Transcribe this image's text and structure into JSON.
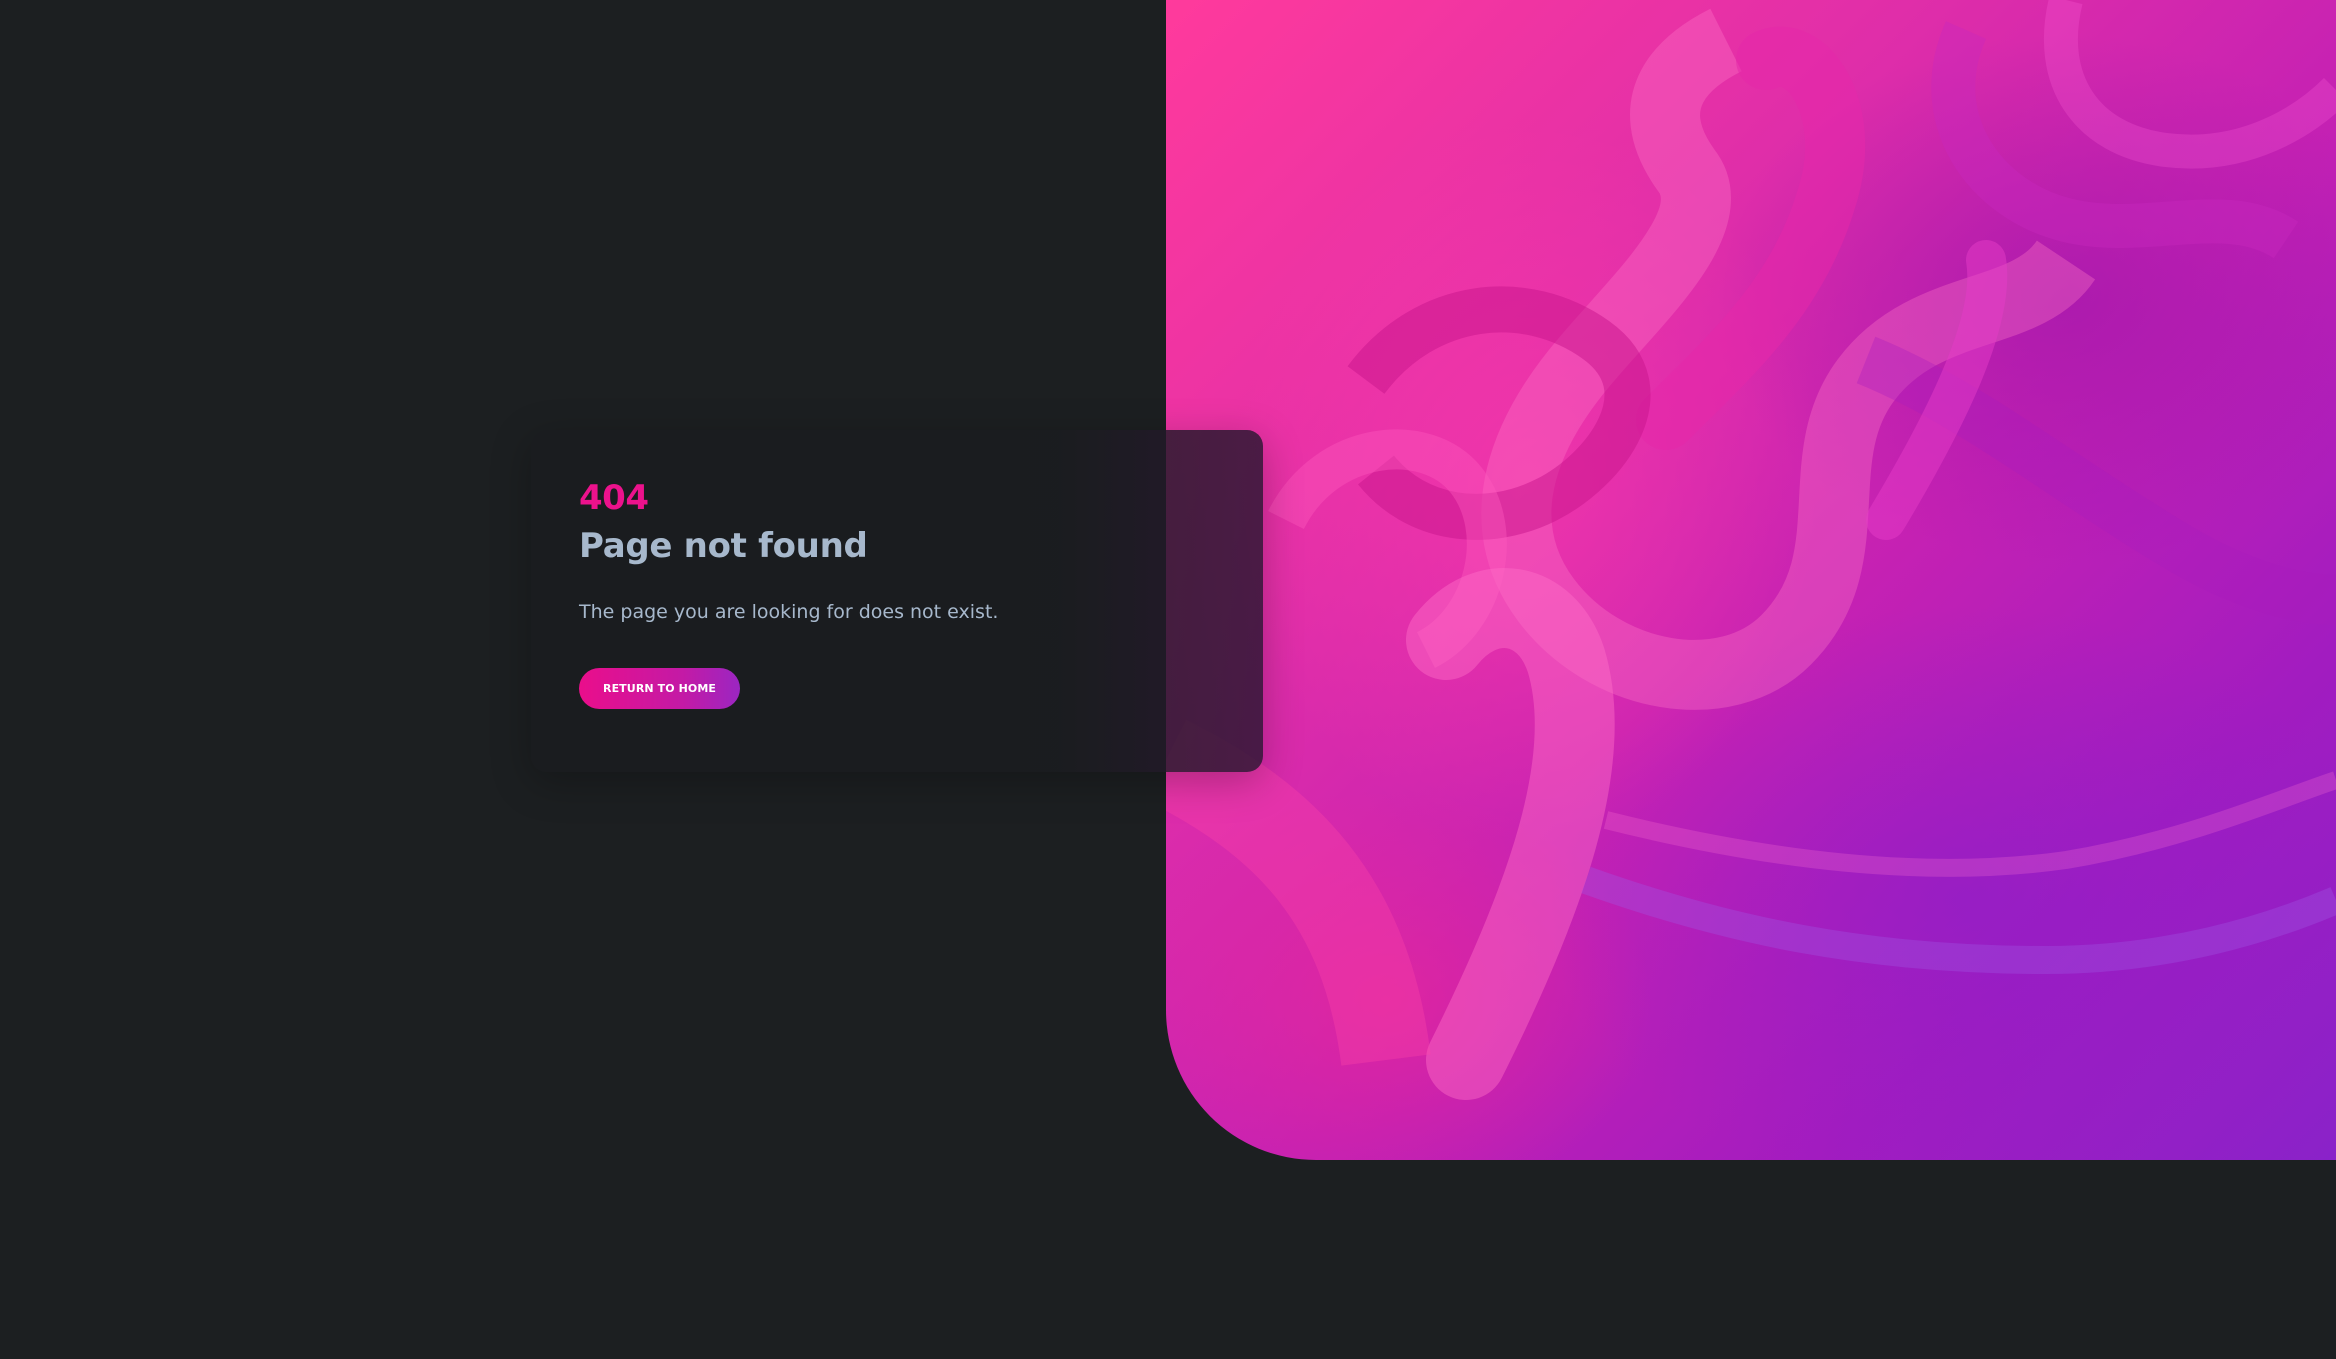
{
  "error": {
    "code": "404",
    "title": "Page not found",
    "message": "The page you are looking for does not exist.",
    "button_label": "RETURN TO HOME"
  },
  "colors": {
    "background": "#1c1f21",
    "accent": "#ec128c",
    "text_muted": "#a7b8cc",
    "card": "#1a1c1f"
  },
  "decor": {
    "hero_image": "abstract-pink-purple-fluid-art"
  }
}
